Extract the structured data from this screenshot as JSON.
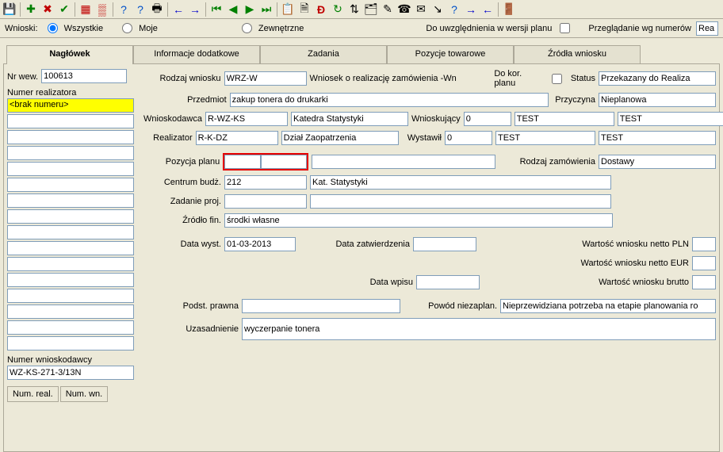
{
  "toolbar_icons": [
    "💾",
    "➕",
    "✖",
    "✔",
    "⟲",
    "🔀",
    "❓",
    "❔",
    "🖨",
    "⬅",
    "➡",
    "⏮",
    "◀",
    "▶",
    "⏭",
    "📋",
    "🧾",
    "D",
    "🔄",
    "⇅",
    "🌲",
    "✎",
    "☎",
    "✉",
    "↘",
    "❓",
    "➡",
    "⬅",
    "🚪"
  ],
  "filter": {
    "wnioski_label": "Wnioski:",
    "wszystkie": "Wszystkie",
    "moje": "Moje",
    "zewnetrzne": "Zewnętrzne",
    "uwzg_label": "Do uwzględnienia w wersji planu",
    "przegladanie_label": "Przeglądanie wg numerów",
    "przegladanie_value": "Rea"
  },
  "tabs": {
    "naglowek": "Nagłówek",
    "info": "Informacje dodatkowe",
    "zadania": "Zadania",
    "pozycje": "Pozycje towarowe",
    "zrodla": "Źródła wniosku"
  },
  "left": {
    "nrwew_label": "Nr wew.",
    "nrwew_value": "100613",
    "realizator_label": "Numer realizatora",
    "realizator_value": "<brak numeru>",
    "wnioskodawcy_label": "Numer wnioskodawcy",
    "wnioskodawcy_value": "WZ-KS-271-3/13N",
    "num_real_btn": "Num. real.",
    "num_wn_btn": "Num. wn."
  },
  "form": {
    "rodzaj_wniosku_label": "Rodzaj wniosku",
    "rodzaj_wniosku_code": "WRZ-W",
    "rodzaj_wniosku_text": "Wniosek o realizację zamówienia -Wn",
    "do_kor_planu_label": "Do kor. planu",
    "status_label": "Status",
    "status_value": "Przekazany do Realiza",
    "przedmiot_label": "Przedmiot",
    "przedmiot_value": "zakup tonera do drukarki",
    "przyczyna_label": "Przyczyna",
    "przyczyna_value": "Nieplanowa",
    "wnioskodawca_label": "Wnioskodawca",
    "wnioskodawca_code": "R-WZ-KS",
    "wnioskodawca_text": "Katedra Statystyki",
    "wnioskujacy_label": "Wnioskujący",
    "wnioskujacy_id": "0",
    "test": "TEST",
    "realizator_label": "Realizator",
    "realizator_code": "R-K-DZ",
    "realizator_text": "Dział Zaopatrzenia",
    "wystawil_label": "Wystawił",
    "wystawil_id": "0",
    "pozycja_planu_label": "Pozycja planu",
    "rodzaj_zam_label": "Rodzaj zamówienia",
    "rodzaj_zam_value": "Dostawy",
    "centrum_label": "Centrum budż.",
    "centrum_code": "212",
    "centrum_text": "Kat. Statystyki",
    "zadanie_proj_label": "Zadanie proj.",
    "zrodlo_fin_label": "Źródło fin.",
    "zrodlo_fin_value": "środki własne",
    "data_wyst_label": "Data wyst.",
    "data_wyst_value": "01-03-2013",
    "data_zatw_label": "Data zatwierdzenia",
    "wartosc_netto_pln_label": "Wartość wniosku netto PLN",
    "wartosc_netto_eur_label": "Wartość wniosku netto EUR",
    "data_wpisu_label": "Data wpisu",
    "wartosc_brutto_label": "Wartość wniosku brutto",
    "podst_prawna_label": "Podst. prawna",
    "powod_label": "Powód niezaplan.",
    "powod_value": "Nieprzewidziana potrzeba na etapie planowania ro",
    "uzasadnienie_label": "Uzasadnienie",
    "uzasadnienie_value": "wyczerpanie tonera"
  }
}
